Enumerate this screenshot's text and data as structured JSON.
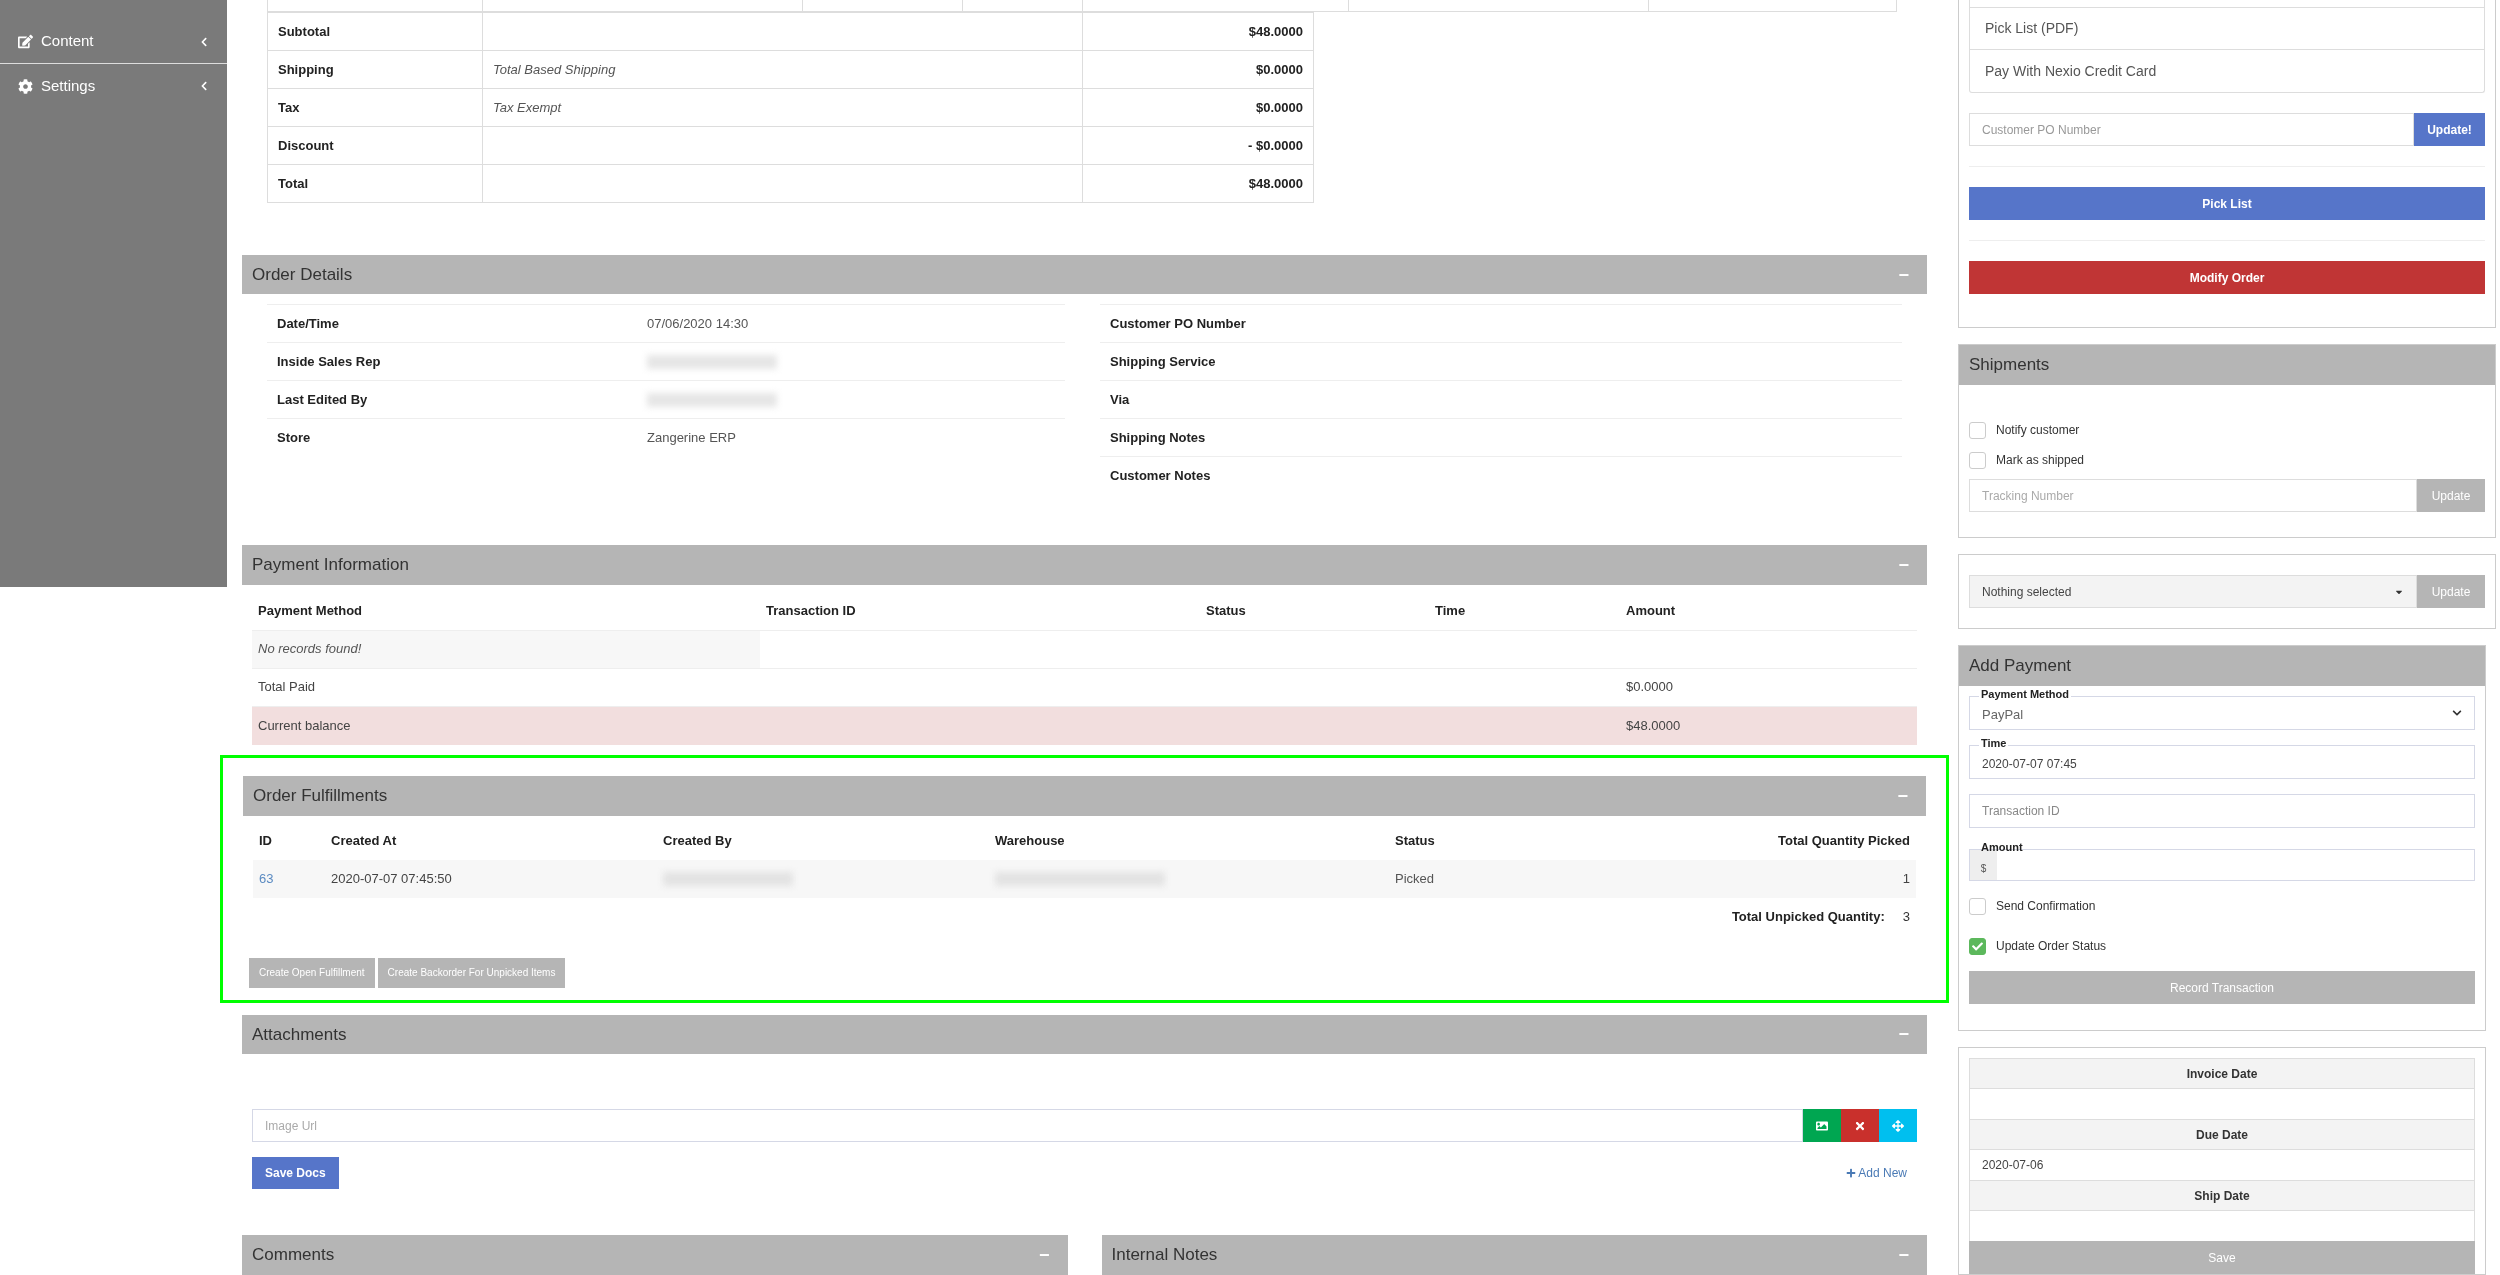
{
  "sidebar": {
    "items": [
      {
        "label": "Content"
      },
      {
        "label": "Settings"
      }
    ]
  },
  "totals": {
    "rows": [
      {
        "label": "Subtotal",
        "amount": "$48.0000"
      },
      {
        "label": "Shipping",
        "note": "Total Based Shipping",
        "amount": "$0.0000"
      },
      {
        "label": "Tax",
        "note": "Tax Exempt",
        "amount": "$0.0000"
      },
      {
        "label": "Discount",
        "amount": "- $0.0000"
      },
      {
        "label": "Total",
        "amount": "$48.0000"
      }
    ]
  },
  "order_details": {
    "title": "Order Details",
    "collapse": "−",
    "left": [
      {
        "label": "Date/Time",
        "kind": "text",
        "value": "07/06/2020 14:30"
      },
      {
        "label": "Inside Sales Rep",
        "kind": "redacted"
      },
      {
        "label": "Last Edited By",
        "kind": "redacted"
      },
      {
        "label": "Store",
        "kind": "text",
        "value": "Zangerine ERP"
      }
    ],
    "right": [
      {
        "label": "Customer PO Number"
      },
      {
        "label": "Shipping Service"
      },
      {
        "label": "Via"
      },
      {
        "label": "Shipping Notes"
      },
      {
        "label": "Customer Notes"
      }
    ]
  },
  "payment_information": {
    "title": "Payment Information",
    "collapse": "−",
    "columns": [
      "Payment Method",
      "Transaction ID",
      "Status",
      "Time",
      "Amount"
    ],
    "empty": "No records found!",
    "summary": [
      {
        "label": "Total Paid",
        "amount": "$0.0000",
        "highlight": false
      },
      {
        "label": "Current balance",
        "amount": "$48.0000",
        "highlight": true
      }
    ]
  },
  "order_fulfillments": {
    "title": "Order Fulfillments",
    "collapse": "−",
    "highlighted": true,
    "columns": [
      "ID",
      "Created At",
      "Created By",
      "Warehouse",
      "Status",
      "Total Quantity Picked"
    ],
    "rows": [
      {
        "id": "63",
        "created_at": "2020-07-07 07:45:50",
        "status": "Picked",
        "picked": "1"
      }
    ],
    "unpicked_label": "Total Unpicked Quantity:",
    "unpicked_value": "3",
    "buttons": [
      "Create Open Fulfillment",
      "Create Backorder For Unpicked Items"
    ]
  },
  "attachments": {
    "title": "Attachments",
    "collapse": "−",
    "image_url": {
      "placeholder": "Image Url"
    },
    "save": "Save Docs",
    "add_new": "Add New"
  },
  "bottom_panels": [
    {
      "title": "Comments",
      "collapse": "−"
    },
    {
      "title": "Internal Notes",
      "collapse": "−"
    }
  ],
  "actions": {
    "links": [
      "Pick List (PDF)",
      "Pay With Nexio Credit Card"
    ],
    "po_field": {
      "placeholder": "Customer PO Number"
    },
    "po_button": "Update!",
    "pick_list": "Pick List",
    "modify_order": "Modify Order"
  },
  "shipments": {
    "title": "Shipments",
    "checkboxes": [
      {
        "label": "Notify customer",
        "checked": false
      },
      {
        "label": "Mark as shipped",
        "checked": false
      }
    ],
    "tracking": {
      "placeholder": "Tracking Number"
    },
    "update": "Update"
  },
  "status_select": {
    "value": "Nothing selected",
    "update": "Update"
  },
  "add_payment": {
    "title": "Add Payment",
    "method": {
      "label": "Payment Method",
      "value": "PayPal"
    },
    "time": {
      "label": "Time",
      "value": "2020-07-07 07:45"
    },
    "transaction": {
      "placeholder": "Transaction ID"
    },
    "amount": {
      "label": "Amount",
      "prefix": "$"
    },
    "checkboxes": [
      {
        "label": "Send Confirmation",
        "checked": false
      },
      {
        "label": "Update Order Status",
        "checked": true
      }
    ],
    "record": "Record Transaction"
  },
  "dates": {
    "rows": [
      {
        "label": "Invoice Date"
      },
      {
        "label": "Due Date",
        "value": "2020-07-06"
      },
      {
        "label": "Ship Date"
      }
    ],
    "save": "Save"
  }
}
